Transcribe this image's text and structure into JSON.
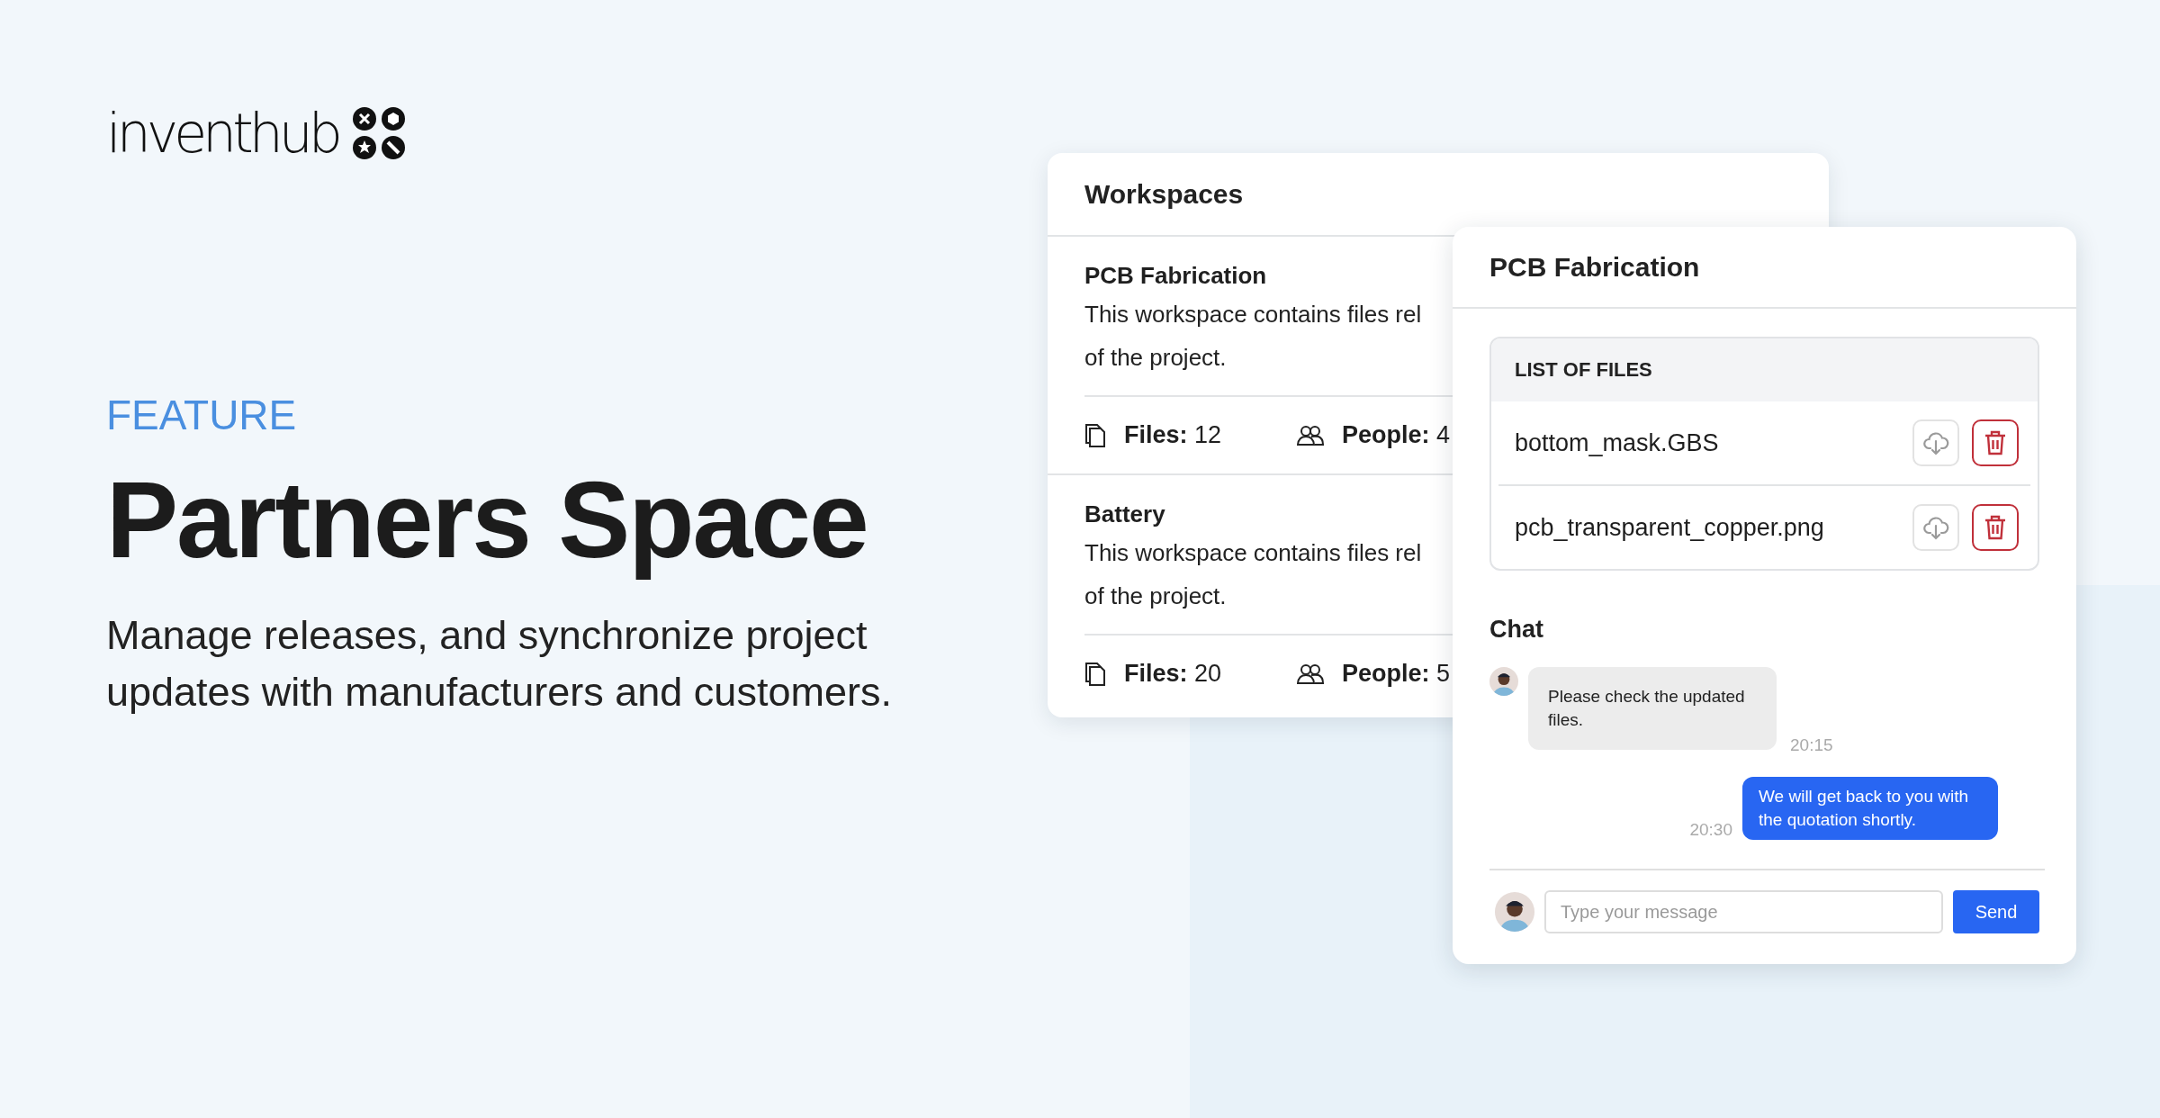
{
  "brand": {
    "name": "inventhub"
  },
  "hero": {
    "eyebrow": "FEATURE",
    "title": "Partners Space",
    "description": "Manage releases, and synchronize project updates with manufacturers and customers."
  },
  "workspaces_panel": {
    "title": "Workspaces",
    "items": [
      {
        "name": "PCB Fabrication",
        "description_lines": [
          "This workspace contains files rel",
          "of the project."
        ],
        "files": "**Files:** 12",
        "people": "**People:** 4"
      },
      {
        "name": "Battery",
        "description_lines": [
          "This workspace contains files rel",
          "of the project."
        ],
        "files": "**Files:** 20",
        "people": "**People:** 5"
      }
    ]
  },
  "workspace_detail": {
    "title": "PCB Fabrication",
    "files": {
      "heading": "LIST OF FILES",
      "items": [
        {
          "name": "bottom_mask.GBS"
        },
        {
          "name": "pcb_transparent_copper.png"
        }
      ]
    },
    "chat": {
      "title": "Chat",
      "messages": [
        {
          "text": "Please check the updated files.",
          "time": "20:15",
          "outgoing": false
        },
        {
          "text": "We will get back to you with the quotation shortly.",
          "time": "20:30",
          "outgoing": true
        }
      ],
      "input": {
        "placeholder": "Type your message"
      },
      "send_button": "Send"
    }
  }
}
